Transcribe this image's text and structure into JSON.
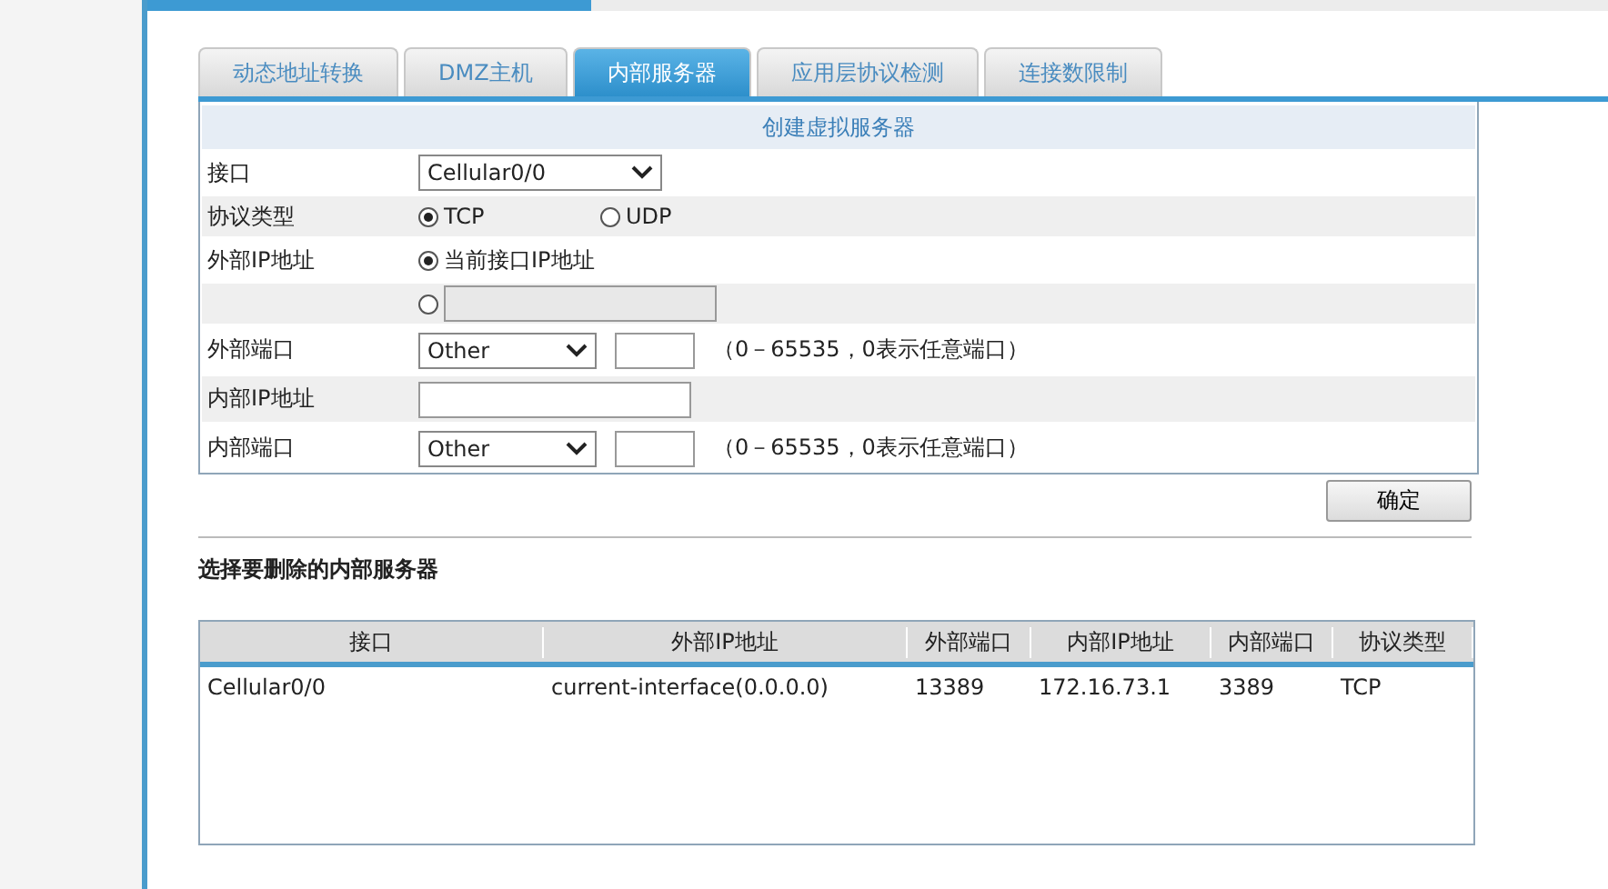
{
  "tabs": [
    {
      "label": "动态地址转换",
      "selected": false
    },
    {
      "label": "DMZ主机",
      "selected": false
    },
    {
      "label": "内部服务器",
      "selected": true
    },
    {
      "label": "应用层协议检测",
      "selected": false
    },
    {
      "label": "连接数限制",
      "selected": false
    }
  ],
  "form": {
    "title": "创建虚拟服务器",
    "rows": [
      {
        "kind": "select",
        "label": "接口",
        "value": "Cellular0/0"
      },
      {
        "kind": "radios",
        "label": "协议类型",
        "options": [
          {
            "label": "TCP",
            "selected": true
          },
          {
            "label": "UDP",
            "selected": false
          }
        ]
      },
      {
        "kind": "radios",
        "label": "外部IP地址",
        "options": [
          {
            "label": "当前接口IP地址",
            "selected": true
          }
        ]
      },
      {
        "kind": "radio-input",
        "selected": false
      },
      {
        "kind": "port",
        "label": "外部端口",
        "value": "Other",
        "hint": "（0－65535，0表示任意端口）"
      },
      {
        "kind": "input",
        "label": "内部IP地址"
      },
      {
        "kind": "port",
        "label": "内部端口",
        "value": "Other",
        "hint": "（0－65535，0表示任意端口）"
      }
    ],
    "submit": "确定"
  },
  "list": {
    "title": "选择要删除的内部服务器",
    "columns": [
      "接口",
      "外部IP地址",
      "外部端口",
      "内部IP地址",
      "内部端口",
      "协议类型"
    ],
    "rows": [
      [
        "Cellular0/0",
        "current-interface(0.0.0.0)",
        "13389",
        "172.16.73.1",
        "3389",
        "TCP"
      ]
    ]
  }
}
